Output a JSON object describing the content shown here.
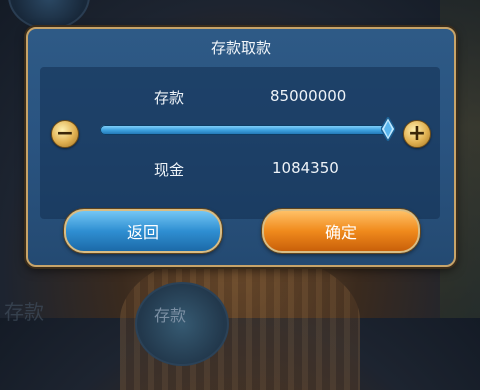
{
  "dialog": {
    "title": "存款取款",
    "deposit": {
      "label": "存款",
      "value": "85000000"
    },
    "cash": {
      "label": "现金",
      "value": "1084350"
    },
    "slider": {
      "level": 1.0,
      "minus_icon": "minus-icon",
      "plus_icon": "plus-icon"
    },
    "buttons": {
      "back_label": "返回",
      "ok_label": "确定"
    }
  },
  "background": {
    "bottom_text": "存款",
    "left_text": "存款"
  },
  "colors": {
    "dialog_bg": "#2a5481",
    "border_gold": "#c7a46a",
    "back_button_blue": "#2f8fd2",
    "ok_button_orange": "#f08a1c",
    "slider_blue": "#3fa3e0"
  }
}
